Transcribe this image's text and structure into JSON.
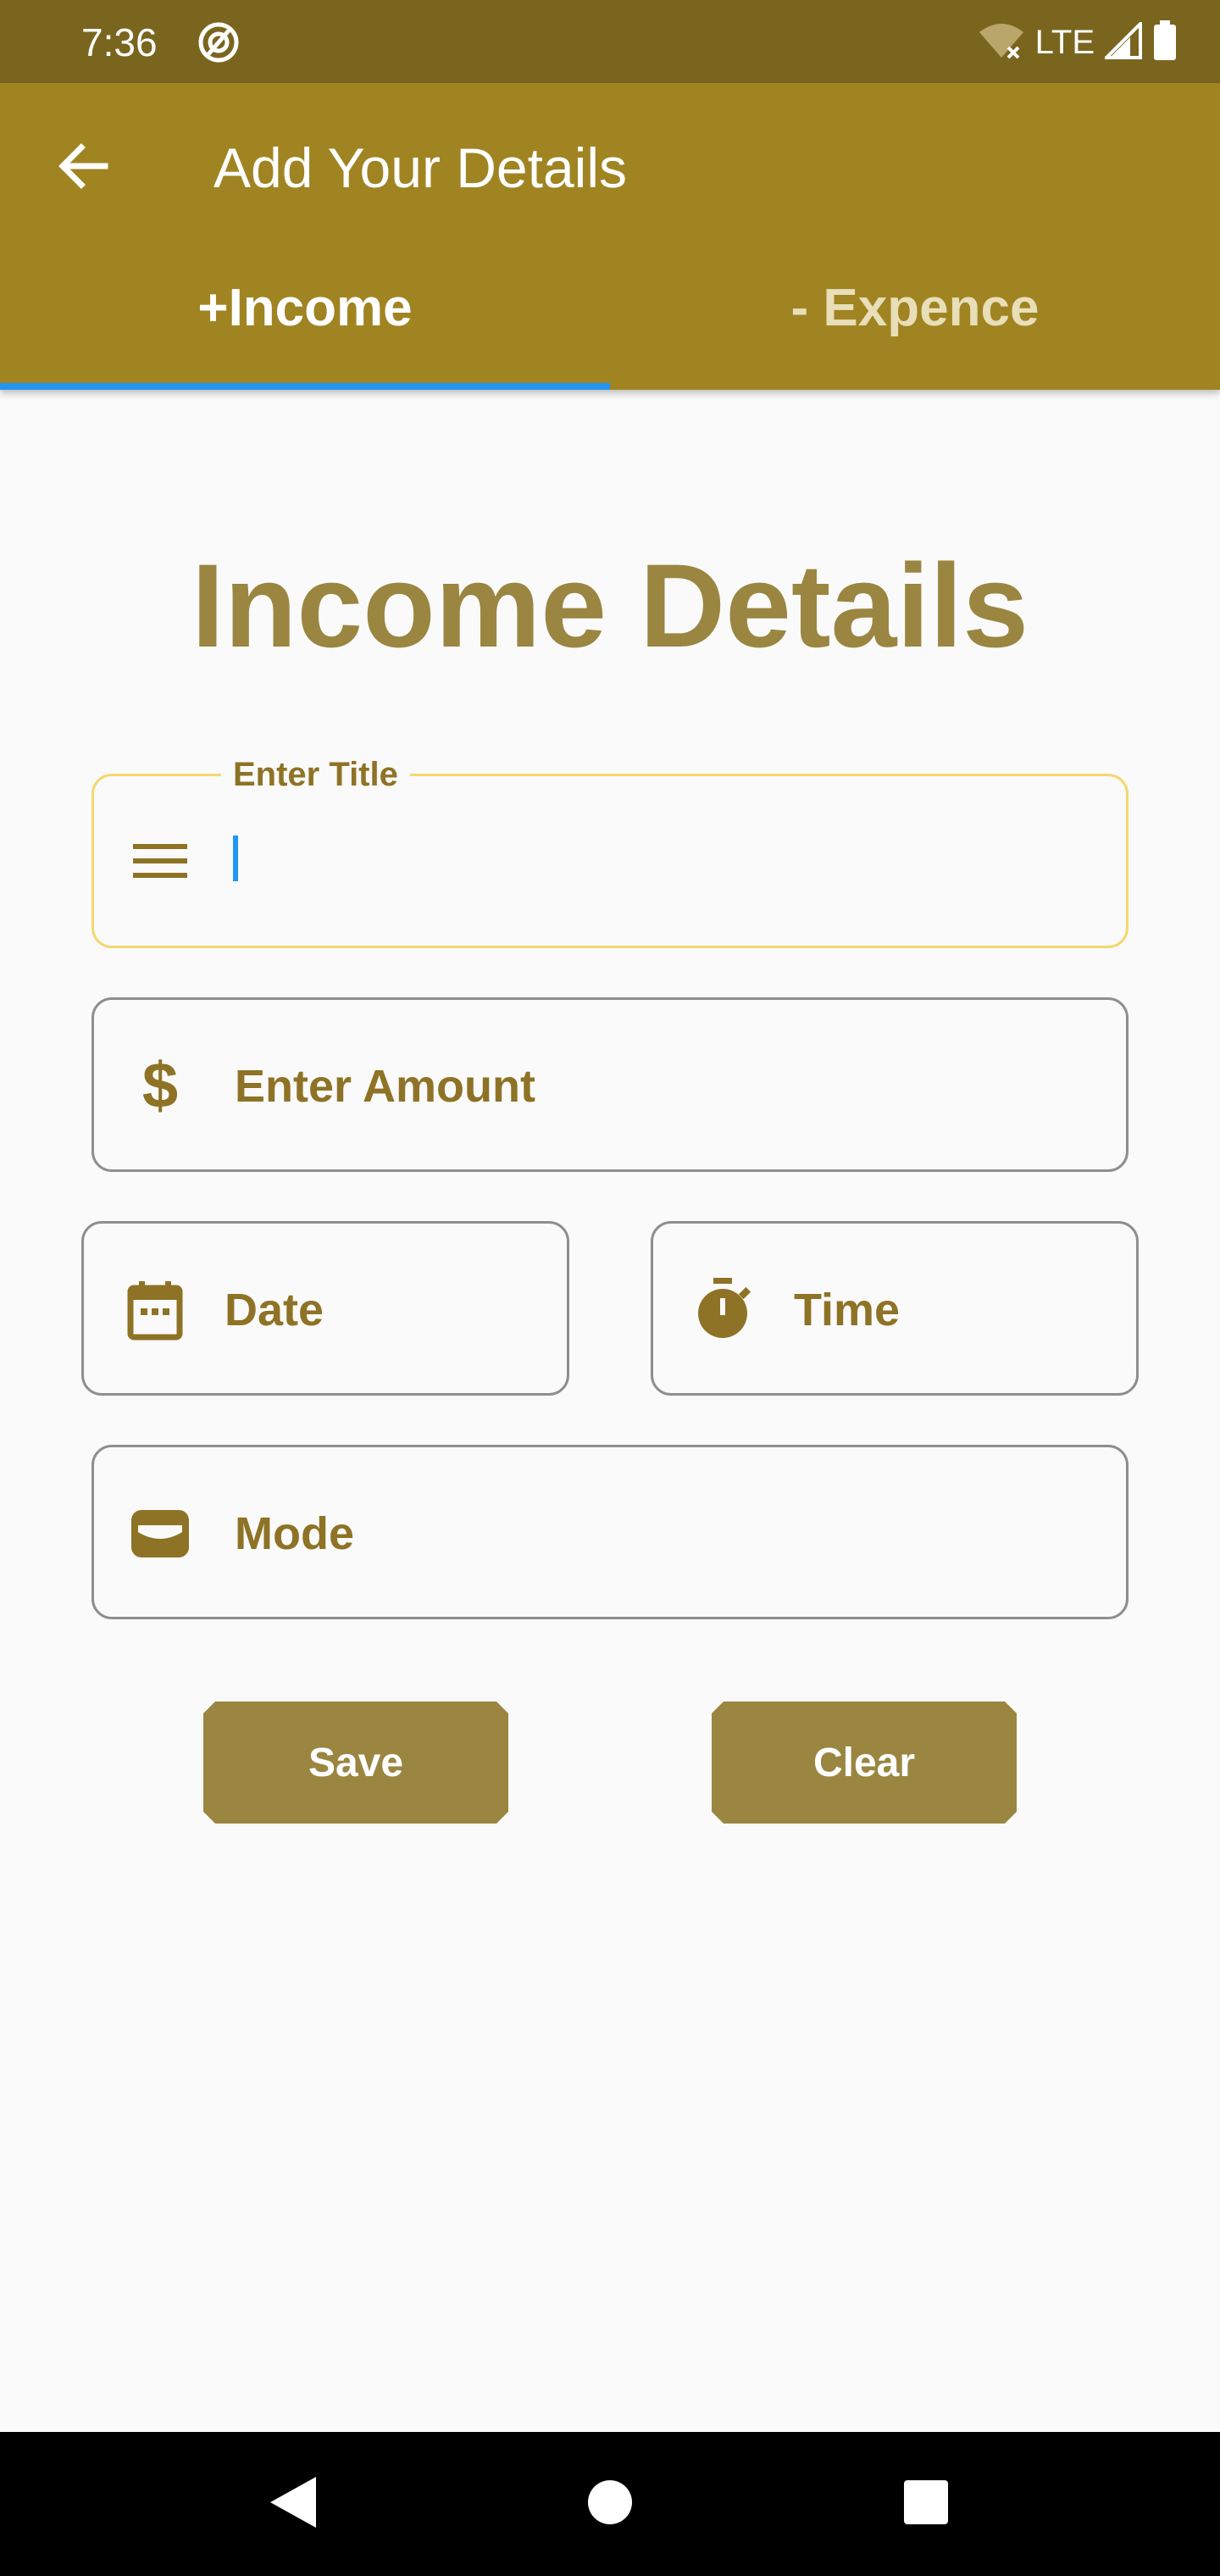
{
  "status_bar": {
    "time": "7:36",
    "network": "LTE",
    "icons": [
      "app-notification-icon",
      "wifi-off-icon",
      "cell-signal-icon",
      "battery-icon"
    ]
  },
  "app_bar": {
    "title": "Add Your Details",
    "back_icon": "arrow-back-icon",
    "tabs": [
      {
        "label": "+Income",
        "selected": true
      },
      {
        "label": "- Expence",
        "selected": false
      }
    ]
  },
  "form": {
    "heading": "Income Details",
    "title_field": {
      "label": "Enter Title",
      "value": "",
      "icon": "menu-lines-icon"
    },
    "amount_field": {
      "placeholder": "Enter Amount",
      "icon": "dollar-icon"
    },
    "date_field": {
      "placeholder": "Date",
      "icon": "calendar-icon"
    },
    "time_field": {
      "placeholder": "Time",
      "icon": "stopwatch-icon"
    },
    "mode_field": {
      "placeholder": "Mode",
      "icon": "wallet-icon"
    },
    "save_label": "Save",
    "clear_label": "Clear"
  },
  "nav_bar": {
    "icons": [
      "back-triangle-icon",
      "home-circle-icon",
      "recents-square-icon"
    ]
  },
  "colors": {
    "status_bar": "#7a651f",
    "app_bar": "#a08422",
    "accent_text": "#8e7326",
    "heading": "#9a8641",
    "button": "#9a8641",
    "tab_indicator": "#2196f3",
    "focused_border": "#f5d76e"
  }
}
